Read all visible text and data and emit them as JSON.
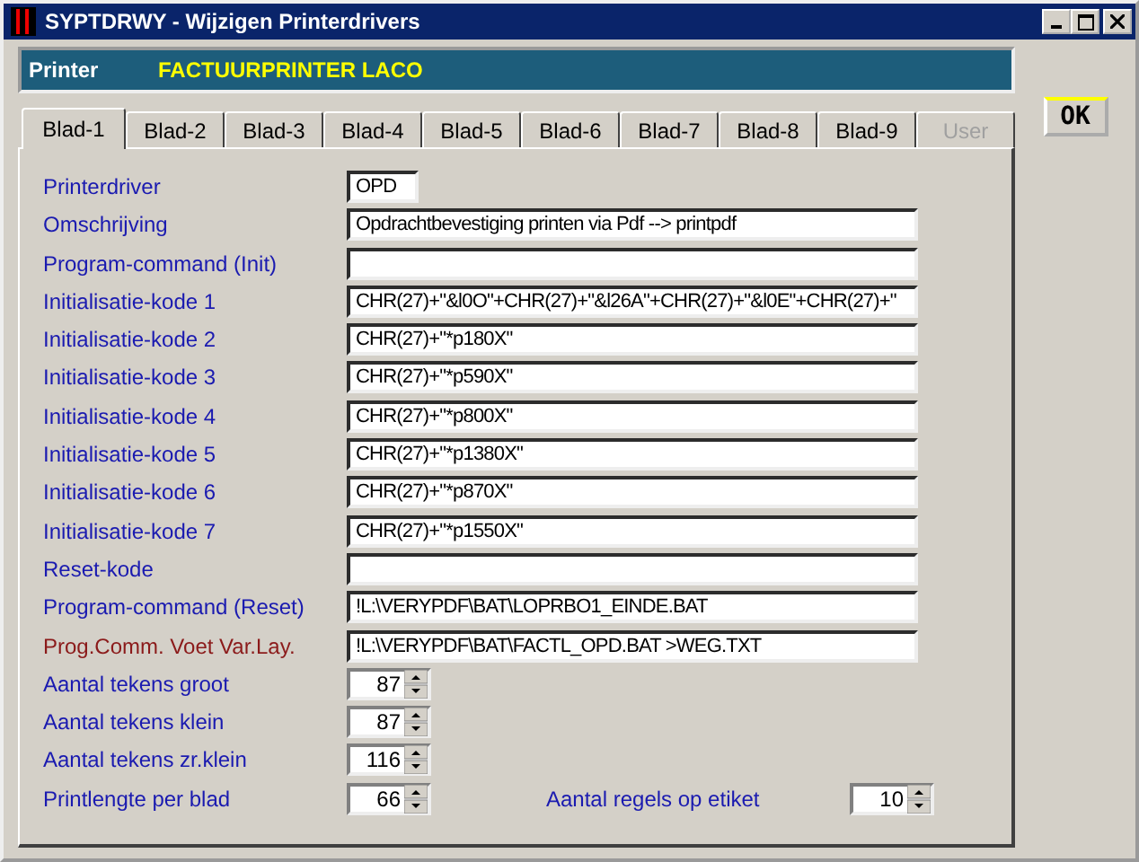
{
  "window": {
    "title": "SYPTDRWY - Wijzigen Printerdrivers"
  },
  "printer": {
    "label": "Printer",
    "value": "FACTUURPRINTER LACO"
  },
  "tabs": [
    {
      "label": "Blad-1",
      "selected": true,
      "disabled": false
    },
    {
      "label": "Blad-2",
      "selected": false,
      "disabled": false
    },
    {
      "label": "Blad-3",
      "selected": false,
      "disabled": false
    },
    {
      "label": "Blad-4",
      "selected": false,
      "disabled": false
    },
    {
      "label": "Blad-5",
      "selected": false,
      "disabled": false
    },
    {
      "label": "Blad-6",
      "selected": false,
      "disabled": false
    },
    {
      "label": "Blad-7",
      "selected": false,
      "disabled": false
    },
    {
      "label": "Blad-8",
      "selected": false,
      "disabled": false
    },
    {
      "label": "Blad-9",
      "selected": false,
      "disabled": false
    },
    {
      "label": "User",
      "selected": false,
      "disabled": true
    }
  ],
  "fields": [
    {
      "label": "Printerdriver",
      "kind": "code",
      "value": "OPD",
      "color": "#1a1ab0"
    },
    {
      "label": "Omschrijving",
      "kind": "text",
      "value": "Opdrachtbevestiging printen via Pdf --> printpdf",
      "color": "#1a1ab0"
    },
    {
      "label": "Program-command (Init)",
      "kind": "text",
      "color": "#1a1ab0"
    },
    {
      "label": "Initialisatie-kode 1",
      "kind": "text",
      "value": "CHR(27)+\"&l0O\"+CHR(27)+\"&l26A\"+CHR(27)+\"&l0E\"+CHR(27)+\"",
      "color": "#1a1ab0"
    },
    {
      "label": "Initialisatie-kode 2",
      "kind": "text",
      "value": "CHR(27)+\"*p180X\"",
      "color": "#1a1ab0"
    },
    {
      "label": "Initialisatie-kode 3",
      "kind": "text",
      "value": "CHR(27)+\"*p590X\"",
      "color": "#1a1ab0"
    },
    {
      "label": "Initialisatie-kode 4",
      "kind": "text",
      "value": "CHR(27)+\"*p800X\"",
      "color": "#1a1ab0"
    },
    {
      "label": "Initialisatie-kode 5",
      "kind": "text",
      "value": "CHR(27)+\"*p1380X\"",
      "color": "#1a1ab0"
    },
    {
      "label": "Initialisatie-kode 6",
      "kind": "text",
      "value": "CHR(27)+\"*p870X\"",
      "color": "#1a1ab0"
    },
    {
      "label": "Initialisatie-kode 7",
      "kind": "text",
      "value": "CHR(27)+\"*p1550X\"",
      "color": "#1a1ab0"
    },
    {
      "label": "Reset-kode",
      "kind": "text",
      "color": "#1a1ab0"
    },
    {
      "label": "Program-command (Reset)",
      "kind": "text",
      "value": "!L:\\VERYPDF\\BAT\\LOPRBO1_EINDE.BAT",
      "color": "#1a1ab0"
    },
    {
      "label": "Prog.Comm. Voet Var.Lay.",
      "kind": "text",
      "value": "!L:\\VERYPDF\\BAT\\FACTL_OPD.BAT >WEG.TXT",
      "color": "#8b1a1a"
    },
    {
      "label": "Aantal tekens groot",
      "kind": "spin",
      "value": "87",
      "color": "#1a1ab0"
    },
    {
      "label": "Aantal tekens klein",
      "kind": "spin",
      "value": "87",
      "color": "#1a1ab0"
    },
    {
      "label": "Aantal tekens zr.klein",
      "kind": "spin",
      "value": "116",
      "color": "#1a1ab0"
    }
  ],
  "last_row": [
    {
      "label": "Printlengte per blad",
      "value": "66"
    },
    {
      "label": "Aantal regels op etiket",
      "value": "10"
    }
  ],
  "ok_button": "OK"
}
